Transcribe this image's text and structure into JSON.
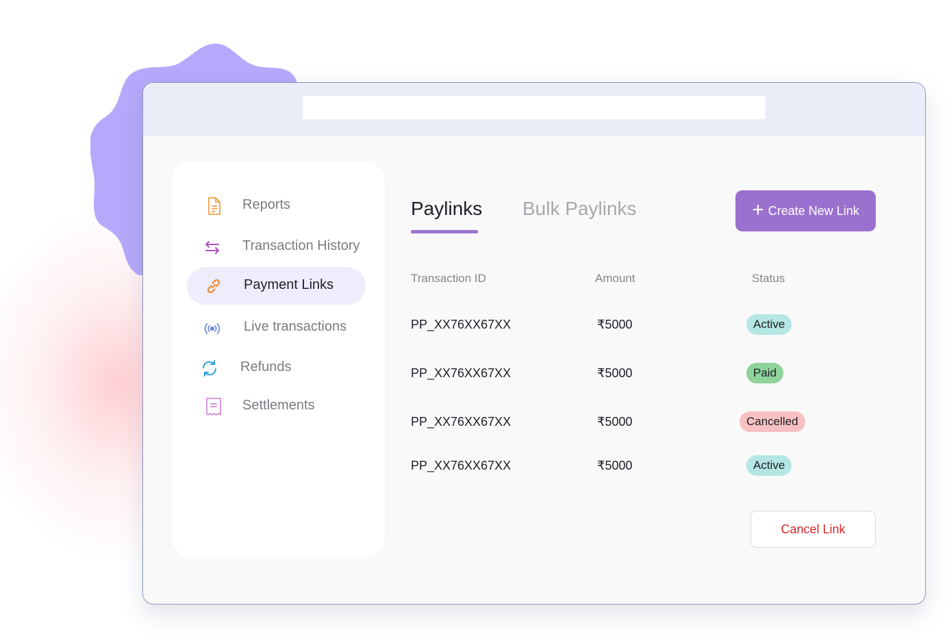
{
  "colors": {
    "accent": "#9b71d0",
    "blob": "#b6a9fb",
    "active_badge": "#b4e7e4",
    "paid_badge": "#8fd39a",
    "cancelled_badge": "#f8c1c1",
    "cancel_text": "#d22b2b"
  },
  "sidebar": {
    "items": [
      {
        "label": "Reports",
        "icon": "document-icon",
        "active": false
      },
      {
        "label": "Transaction History",
        "icon": "swap-arrows-icon",
        "active": false
      },
      {
        "label": "Payment Links",
        "icon": "link-icon",
        "active": true
      },
      {
        "label": "Live transactions",
        "icon": "broadcast-icon",
        "active": false
      },
      {
        "label": "Refunds",
        "icon": "refresh-icon",
        "active": false
      },
      {
        "label": "Settlements",
        "icon": "receipt-icon",
        "active": false
      }
    ]
  },
  "tabs": [
    {
      "label": "Paylinks",
      "active": true
    },
    {
      "label": "Bulk Paylinks",
      "active": false
    }
  ],
  "create_button": {
    "icon": "plus-icon",
    "label": "Create New Link"
  },
  "table": {
    "headers": [
      "Transaction ID",
      "Amount",
      "Status"
    ],
    "rows": [
      {
        "id": "PP_XX76XX67XX",
        "amount": "₹5000",
        "status": "Active"
      },
      {
        "id": "PP_XX76XX67XX",
        "amount": "₹5000",
        "status": "Paid"
      },
      {
        "id": "PP_XX76XX67XX",
        "amount": "₹5000",
        "status": "Cancelled"
      },
      {
        "id": "PP_XX76XX67XX",
        "amount": "₹5000",
        "status": "Active"
      }
    ]
  },
  "cancel_button": {
    "label": "Cancel Link"
  }
}
